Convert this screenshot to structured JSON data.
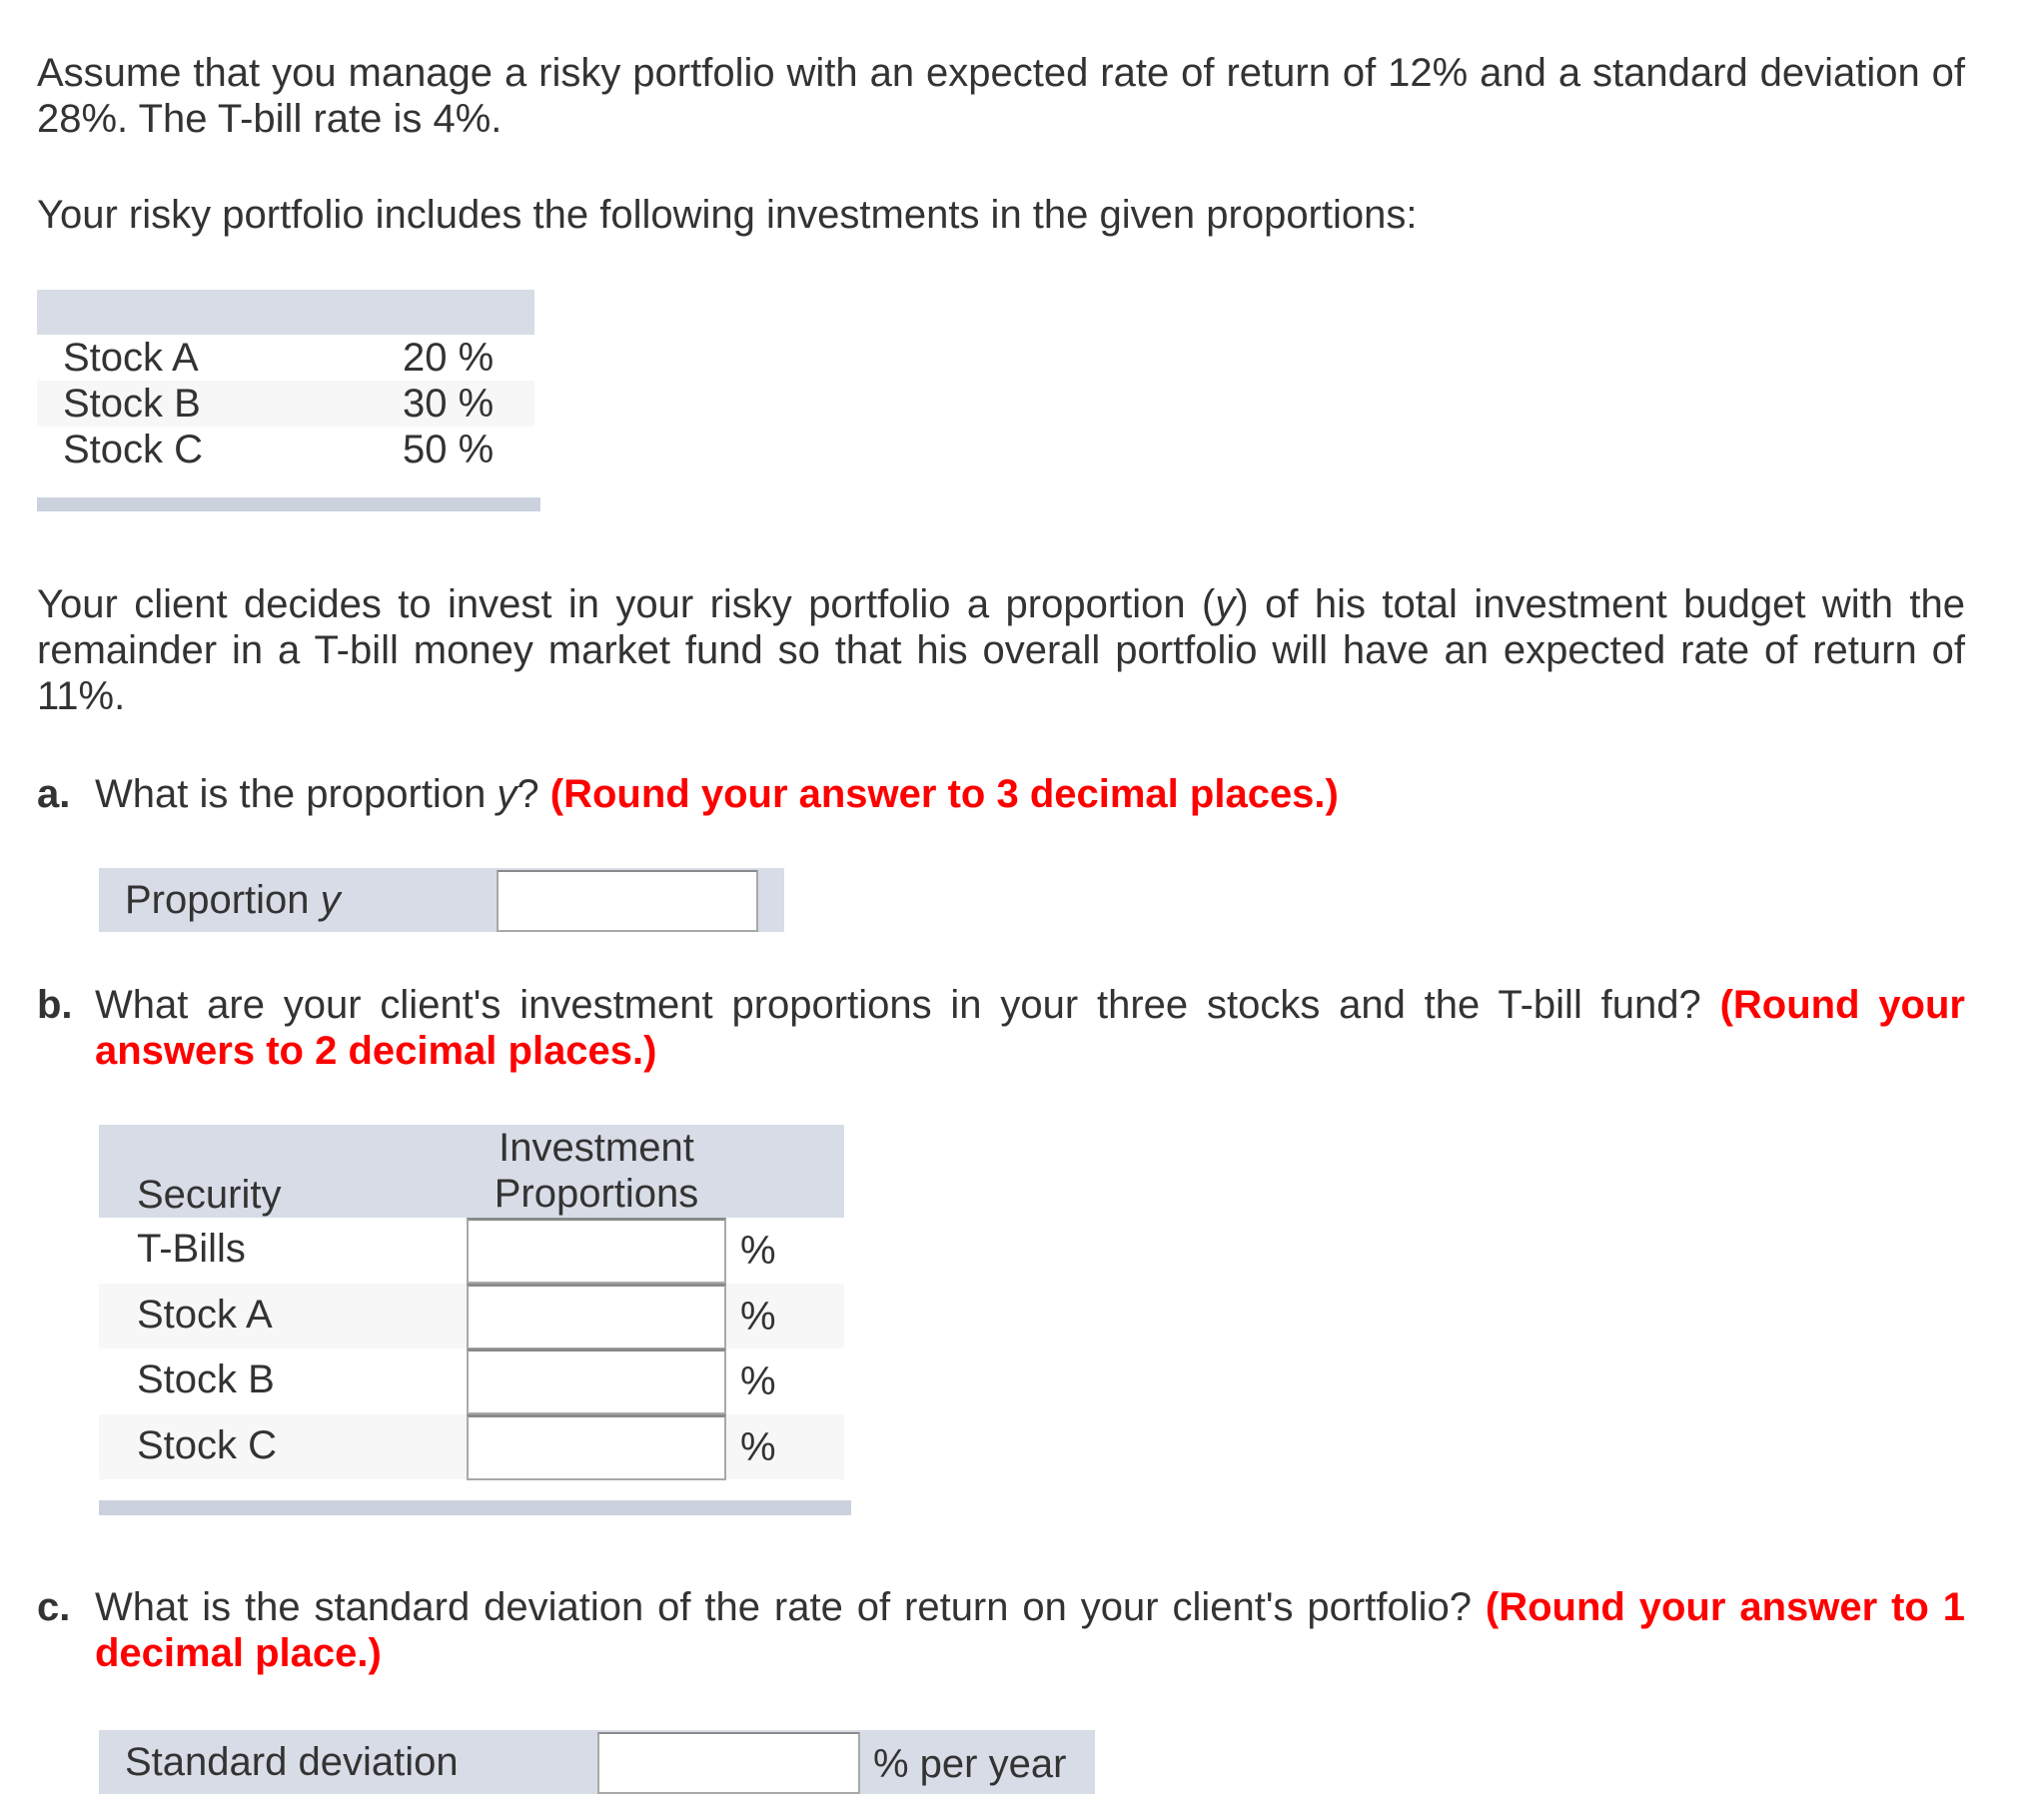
{
  "intro": {
    "paragraph1": "Assume that you manage a risky portfolio with an expected rate of return of 12% and a standard deviation of 28%. The T-bill rate is 4%.",
    "paragraph2": "Your risky portfolio includes the following investments in the given proportions:",
    "paragraph3_part1": "Your client decides to invest in your risky portfolio a proportion (",
    "paragraph3_var": "y",
    "paragraph3_part2": ") of his total investment budget with the remainder in a T-bill money market fund so that his overall portfolio will have an expected rate of return of 11%."
  },
  "risky_portfolio_table": {
    "rows": [
      {
        "name": "Stock A",
        "value": "20 %"
      },
      {
        "name": "Stock B",
        "value": "30 %"
      },
      {
        "name": "Stock C",
        "value": "50 %"
      }
    ]
  },
  "question_a": {
    "label": "a.",
    "text_part1": "What is the proportion ",
    "var": "y",
    "text_part2": "? ",
    "instruction": "(Round your answer to 3 decimal places.)",
    "field_label": "Proportion ",
    "field_label_var": "y",
    "field_value": ""
  },
  "question_b": {
    "label": "b.",
    "text": "What are your client's investment proportions in your three stocks and the T-bill fund? ",
    "instruction": "(Round your answers to 2 decimal places.)",
    "header_security": "Security",
    "header_proportions_line1": "Investment",
    "header_proportions_line2": "Proportions",
    "rows": [
      {
        "name": "T-Bills",
        "value": "",
        "unit": "%"
      },
      {
        "name": "Stock A",
        "value": "",
        "unit": "%"
      },
      {
        "name": "Stock B",
        "value": "",
        "unit": "%"
      },
      {
        "name": "Stock C",
        "value": "",
        "unit": "%"
      }
    ]
  },
  "question_c": {
    "label": "c.",
    "text": "What is the standard deviation of the rate of return on your client's portfolio? ",
    "instruction": "(Round your answer to 1 decimal place.)",
    "field_label": "Standard deviation",
    "field_value": "",
    "unit": "% per year"
  },
  "colors": {
    "instruction_red": "#ff0000",
    "table_header": "#d7dce6",
    "table_footer": "#cbd2de",
    "alt_row": "#f7f7f7",
    "text": "#333333"
  }
}
